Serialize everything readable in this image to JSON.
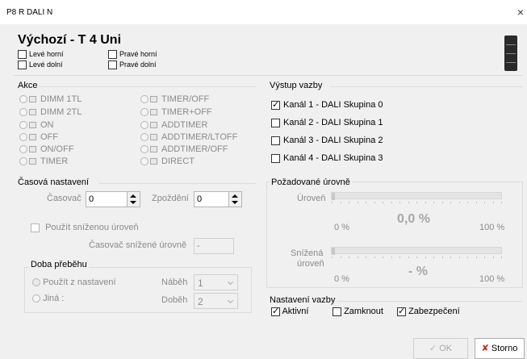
{
  "window": {
    "title": "P8 R DALI N",
    "close_glyph": "×"
  },
  "header": {
    "title": "Výchozí - T 4 Uni",
    "buttons": [
      {
        "label": "Levé horní",
        "checked": false
      },
      {
        "label": "Pravé horní",
        "checked": false
      },
      {
        "label": "Levé dolní",
        "checked": false
      },
      {
        "label": "Pravé dolní",
        "checked": false
      }
    ]
  },
  "akce": {
    "title": "Akce",
    "options": [
      "DIMM 1TL",
      "DIMM 2TL",
      "ON",
      "OFF",
      "ON/OFF",
      "TIMER",
      "TIMER/OFF",
      "TIMER+OFF",
      "ADDTIMER",
      "ADDTIMER/LTOFF",
      "ADDTIMER/OFF",
      "DIRECT"
    ]
  },
  "vystup": {
    "title": "Výstup vazby",
    "channels": [
      {
        "label": "Kanál 1 - DALI Skupina 0",
        "checked": true
      },
      {
        "label": "Kanál 2 - DALI Skupina 1",
        "checked": false
      },
      {
        "label": "Kanál 3 - DALI Skupina 2",
        "checked": false
      },
      {
        "label": "Kanál 4 - DALI Skupina 3",
        "checked": false
      }
    ]
  },
  "casova": {
    "title": "Časová nastavení",
    "timer_label": "Časovač",
    "timer_value": "0",
    "delay_label": "Zpoždění",
    "delay_value": "0",
    "reduced_label": "Použít sníženou úroveň",
    "reduced_timer_label": "Časovač snížené úrovně",
    "reduced_timer_value": "-",
    "doba_title": "Doba přeběhu",
    "use_settings_label": "Použít z nastavení",
    "other_label": "Jiná :",
    "rise_label": "Náběh",
    "rise_value": "1",
    "fall_label": "Doběh",
    "fall_value": "2"
  },
  "urovne": {
    "title": "Požadované úrovně",
    "level_label": "Úroveň",
    "level_value": "0,0 %",
    "level_min": "0 %",
    "level_max": "100 %",
    "level_fraction": 0,
    "reduced_label_1": "Snížená",
    "reduced_label_2": "úroveň",
    "reduced_value": "- %",
    "reduced_min": "0 %",
    "reduced_max": "100 %",
    "reduced_fraction": 0
  },
  "nastaveni": {
    "title": "Nastavení vazby",
    "active_label": "Aktivní",
    "active_checked": true,
    "lock_label": "Zamknout",
    "lock_checked": false,
    "secure_label": "Zabezpečení",
    "secure_checked": true
  },
  "footer": {
    "ok_label": "OK",
    "ok_icon": "check-icon",
    "cancel_label": "Storno",
    "cancel_icon": "x-icon",
    "cancel_icon_color": "#c0281c"
  }
}
